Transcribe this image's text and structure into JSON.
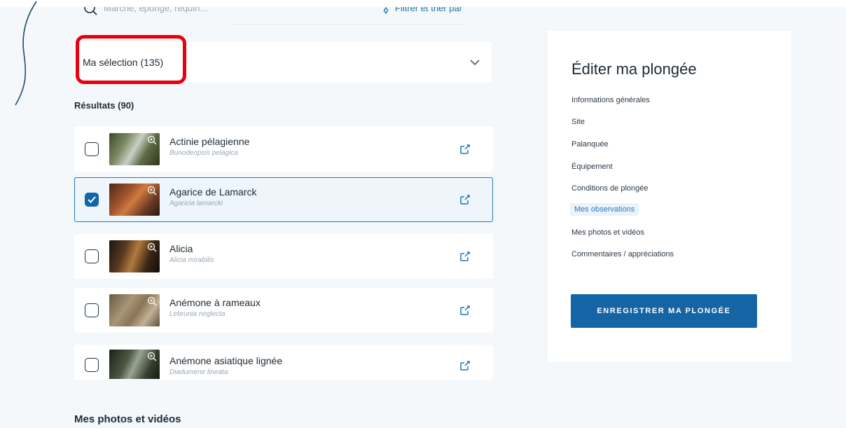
{
  "search": {
    "placeholder": "Marche, éponge, requin...",
    "filter_label": "Filtrer et trier par"
  },
  "selection": {
    "label": "Ma sélection (135)"
  },
  "results": {
    "title": "Résultats (90)",
    "items": [
      {
        "name": "Actinie pélagienne",
        "latin": "Bunodeopsis pelagica",
        "checked": false
      },
      {
        "name": "Agarice de Lamarck",
        "latin": "Agaricia lamarcki",
        "checked": true
      },
      {
        "name": "Alicia",
        "latin": "Alicia mirabilis",
        "checked": false
      },
      {
        "name": "Anémone à rameaux",
        "latin": "Lebrunia neglecta",
        "checked": false
      },
      {
        "name": "Anémone asiatique lignée",
        "latin": "Diadumene lineata",
        "checked": false
      }
    ]
  },
  "photos_section": {
    "title": "Mes photos et vidéos"
  },
  "panel": {
    "title": "Éditer ma plongée",
    "nav": [
      "Informations générales",
      "Site",
      "Palanquée",
      "Équipement",
      "Conditions de plongée",
      "Mes observations",
      "Mes photos et vidéos",
      "Commentaires / appréciations"
    ],
    "active_index": 5,
    "save_label": "ENREGISTRER MA PLONGÉE"
  },
  "colors": {
    "accent": "#1565a5",
    "highlight": "#e8000d",
    "active_link": "#2c7bb8"
  },
  "icons": [
    "search-icon",
    "filter-icon",
    "chevron-down-icon",
    "zoom-icon",
    "external-link-icon",
    "checkmark-icon"
  ]
}
